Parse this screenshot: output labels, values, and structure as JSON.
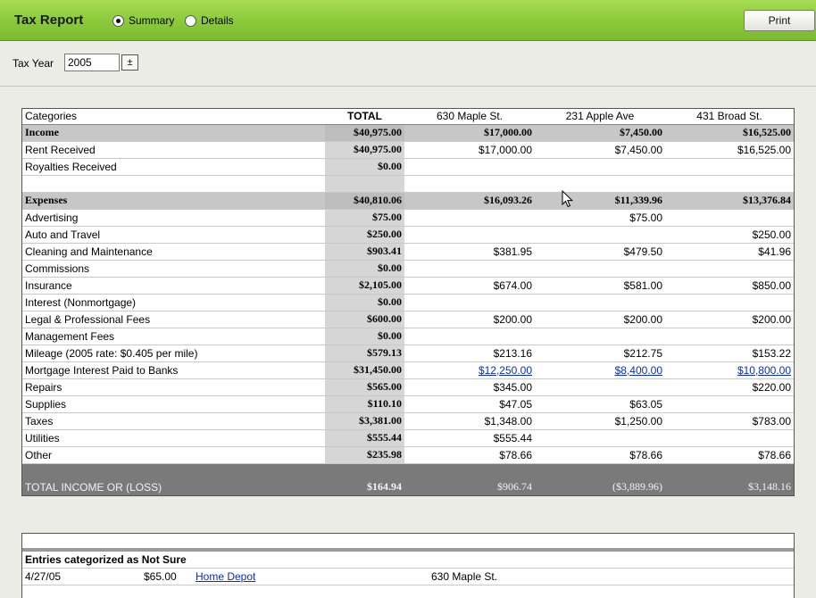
{
  "header": {
    "title": "Tax Report",
    "view_options": [
      {
        "label": "Summary",
        "selected": true
      },
      {
        "label": "Details",
        "selected": false
      }
    ],
    "print_label": "Print"
  },
  "tax_year": {
    "label": "Tax Year",
    "value": "2005",
    "spin_icon": "±"
  },
  "report": {
    "columns": [
      "Categories",
      "TOTAL",
      "630 Maple St.",
      "231 Apple Ave",
      "431 Broad St."
    ],
    "income": {
      "label": "Income",
      "total": "$40,975.00",
      "c1": "$17,000.00",
      "c2": "$7,450.00",
      "c3": "$16,525.00",
      "rows": [
        {
          "label": "Rent Received",
          "total": "$40,975.00",
          "c1": "$17,000.00",
          "c2": "$7,450.00",
          "c3": "$16,525.00"
        },
        {
          "label": "Royalties Received",
          "total": "$0.00",
          "c1": "",
          "c2": "",
          "c3": ""
        }
      ]
    },
    "expenses": {
      "label": "Expenses",
      "total": "$40,810.06",
      "c1": "$16,093.26",
      "c2": "$11,339.96",
      "c3": "$13,376.84",
      "rows": [
        {
          "label": "Advertising",
          "total": "$75.00",
          "c1": "",
          "c2": "$75.00",
          "c3": ""
        },
        {
          "label": "Auto and Travel",
          "total": "$250.00",
          "c1": "",
          "c2": "",
          "c3": "$250.00"
        },
        {
          "label": "Cleaning and Maintenance",
          "total": "$903.41",
          "c1": "$381.95",
          "c2": "$479.50",
          "c3": "$41.96"
        },
        {
          "label": "Commissions",
          "total": "$0.00",
          "c1": "",
          "c2": "",
          "c3": ""
        },
        {
          "label": "Insurance",
          "total": "$2,105.00",
          "c1": "$674.00",
          "c2": "$581.00",
          "c3": "$850.00"
        },
        {
          "label": "Interest (Nonmortgage)",
          "total": "$0.00",
          "c1": "",
          "c2": "",
          "c3": ""
        },
        {
          "label": "Legal & Professional Fees",
          "total": "$600.00",
          "c1": "$200.00",
          "c2": "$200.00",
          "c3": "$200.00"
        },
        {
          "label": "Management Fees",
          "total": "$0.00",
          "c1": "",
          "c2": "",
          "c3": ""
        },
        {
          "label": "Mileage (2005 rate: $0.405 per mile)",
          "total": "$579.13",
          "c1": "$213.16",
          "c2": "$212.75",
          "c3": "$153.22"
        },
        {
          "label": "Mortgage Interest Paid to Banks",
          "total": "$31,450.00",
          "c1": "$12,250.00",
          "c2": "$8,400.00",
          "c3": "$10,800.00",
          "linked": true
        },
        {
          "label": "Repairs",
          "total": "$565.00",
          "c1": "$345.00",
          "c2": "",
          "c3": "$220.00"
        },
        {
          "label": "Supplies",
          "total": "$110.10",
          "c1": "$47.05",
          "c2": "$63.05",
          "c3": ""
        },
        {
          "label": "Taxes",
          "total": "$3,381.00",
          "c1": "$1,348.00",
          "c2": "$1,250.00",
          "c3": "$783.00"
        },
        {
          "label": "Utilities",
          "total": "$555.44",
          "c1": "$555.44",
          "c2": "",
          "c3": ""
        },
        {
          "label": "Other",
          "total": "$235.98",
          "c1": "$78.66",
          "c2": "$78.66",
          "c3": "$78.66"
        }
      ]
    },
    "grand_total": {
      "label": "TOTAL INCOME OR (LOSS)",
      "total": "$164.94",
      "c1": "$906.74",
      "c2": "($3,889.96)",
      "c3": "$3,148.16"
    }
  },
  "not_sure": {
    "heading": "Entries categorized as Not Sure",
    "entries": [
      {
        "date": "4/27/05",
        "amount": "$65.00",
        "payee": "Home Depot",
        "property": "630 Maple St."
      }
    ]
  },
  "colors": {
    "accent": "#8ac93a",
    "link": "#0a2bd0",
    "total_bar": "#7a7a7a"
  }
}
